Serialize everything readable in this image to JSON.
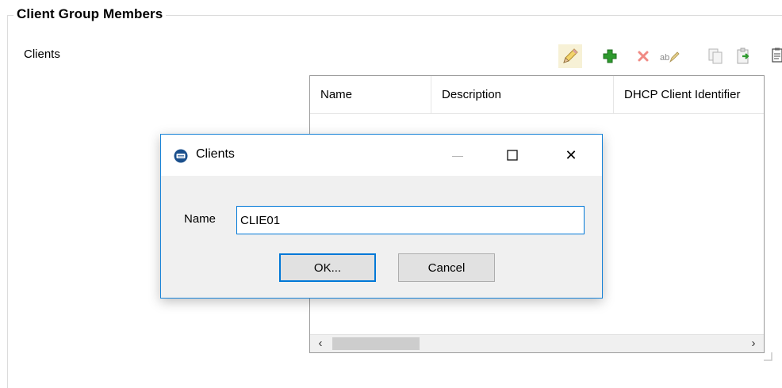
{
  "group": {
    "title": "Client Group Members"
  },
  "clients_label": "Clients",
  "toolbar": {
    "items": [
      {
        "name": "edit",
        "icon": "pencil-icon"
      },
      {
        "name": "add",
        "icon": "plus-icon"
      },
      {
        "name": "delete",
        "icon": "delete-x-icon"
      },
      {
        "name": "rename",
        "icon": "rename-icon"
      },
      {
        "name": "copy",
        "icon": "copy-icon"
      },
      {
        "name": "paste",
        "icon": "paste-icon"
      },
      {
        "name": "properties",
        "icon": "clipboard-icon"
      }
    ]
  },
  "grid": {
    "columns": [
      "Name",
      "Description",
      "DHCP Client Identifier"
    ],
    "scroll_left": "‹",
    "scroll_right": "›"
  },
  "dialog": {
    "title": "Clients",
    "minimize": "—",
    "close": "✕",
    "name_label": "Name",
    "name_value": "CLIE01",
    "ok_label": "OK...",
    "cancel_label": "Cancel"
  },
  "colors": {
    "accent": "#0078d7",
    "dialog_border": "#1883d7",
    "add_green": "#2e9a2e",
    "delete_red": "#e0433a"
  }
}
